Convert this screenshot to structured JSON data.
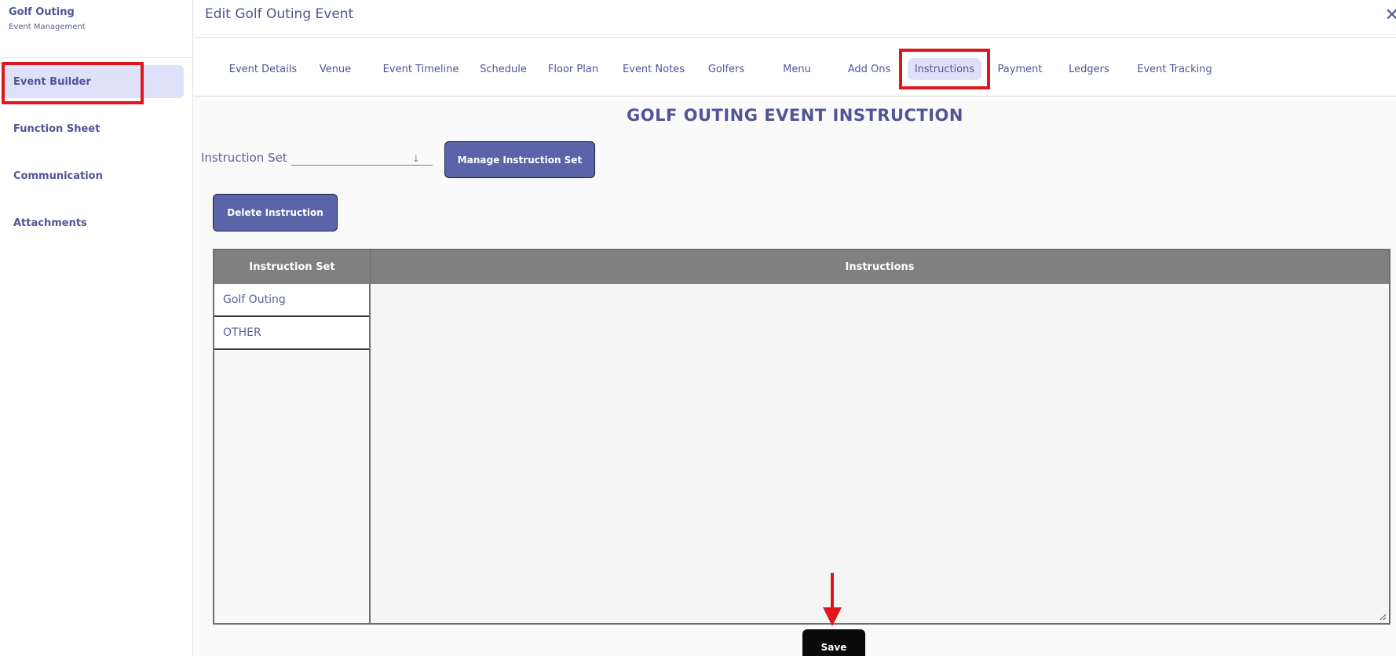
{
  "brand": {
    "title": "Golf Outing",
    "subtitle": "Event Management"
  },
  "sidebar": {
    "items": [
      {
        "label": "Event Builder"
      },
      {
        "label": "Function Sheet"
      },
      {
        "label": "Communication"
      },
      {
        "label": "Attachments"
      }
    ]
  },
  "header": {
    "title": "Edit Golf Outing Event",
    "close_icon": "close-icon"
  },
  "tabs": [
    {
      "label": "Event Details"
    },
    {
      "label": "Venue"
    },
    {
      "label": "Event Timeline"
    },
    {
      "label": "Schedule"
    },
    {
      "label": "Floor Plan"
    },
    {
      "label": "Event Notes"
    },
    {
      "label": "Golfers"
    },
    {
      "label": "Menu"
    },
    {
      "label": "Add Ons"
    },
    {
      "label": "Instructions"
    },
    {
      "label": "Payment"
    },
    {
      "label": "Ledgers"
    },
    {
      "label": "Event Tracking"
    }
  ],
  "main": {
    "title": "GOLF OUTING EVENT INSTRUCTION",
    "instruction_set_label": "Instruction Set",
    "instruction_set_value": "",
    "manage_button": "Manage Instruction Set",
    "delete_button": "Delete Instruction",
    "table": {
      "headers": [
        "Instruction Set",
        "Instructions"
      ],
      "rows": [
        "Golf Outing",
        "OTHER"
      ],
      "instructions_text": ""
    },
    "save_button": "Save"
  },
  "colors": {
    "accent": "#5b64a8",
    "text": "#4f5596",
    "active_bg": "#dfe1fa",
    "highlight": "#e0161e",
    "table_header": "#808080"
  }
}
